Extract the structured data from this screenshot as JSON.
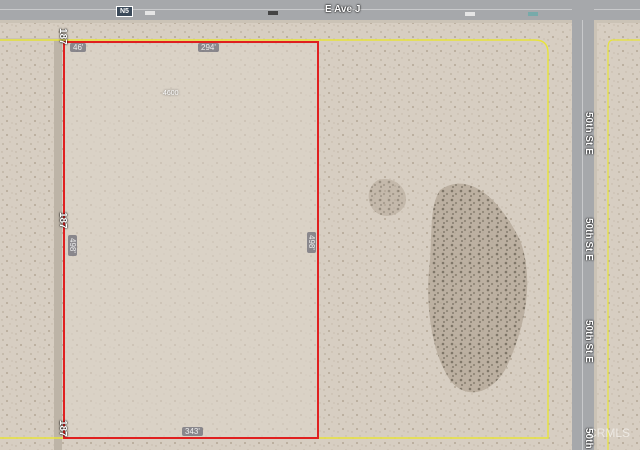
{
  "map": {
    "roads": {
      "top": "E Ave J",
      "right": "50th St E",
      "left": "187"
    },
    "right_road_labels": [
      "50th St E",
      "50th St E",
      "50th St E",
      "50th"
    ],
    "left_road_labels": [
      "187",
      "187",
      "187"
    ],
    "highway_shield": "N5",
    "parcel_number": "4600",
    "dimensions": {
      "top": "294'",
      "bottom": "343'",
      "left": "498'",
      "right": "498'",
      "top_left_small": "46'"
    },
    "watermark": "CRMLS",
    "colors": {
      "parcel_outline": "#e02020",
      "lot_lines": "#e8e43a",
      "road": "#a6a8ab",
      "ground": "#d9d0c4"
    }
  }
}
